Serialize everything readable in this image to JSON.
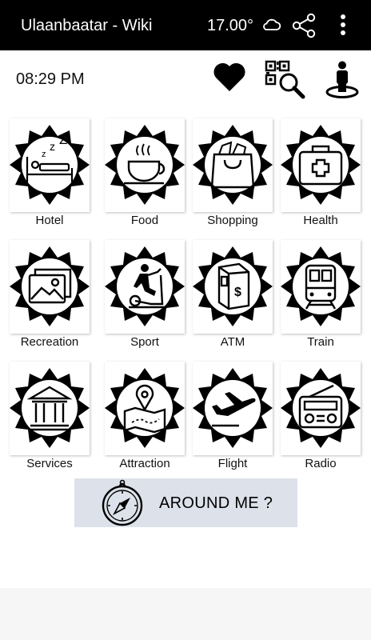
{
  "appbar": {
    "title": "Ulaanbaatar - Wiki",
    "temperature": "17.00°",
    "weather_icon": "cloud-icon",
    "share_icon": "share-icon",
    "menu_icon": "more-vert-icon"
  },
  "subbar": {
    "time": "08:29 PM",
    "favorite_icon": "heart-icon",
    "qr_icon": "qr-search-icon",
    "location_icon": "person-pin-icon"
  },
  "categories": [
    {
      "label": "Hotel",
      "icon": "bed-icon"
    },
    {
      "label": "Food",
      "icon": "coffee-cup-icon"
    },
    {
      "label": "Shopping",
      "icon": "shopping-bag-icon"
    },
    {
      "label": "Health",
      "icon": "first-aid-kit-icon"
    },
    {
      "label": "Recreation",
      "icon": "photos-icon"
    },
    {
      "label": "Sport",
      "icon": "exercise-bike-icon"
    },
    {
      "label": "ATM",
      "icon": "atm-machine-icon"
    },
    {
      "label": "Train",
      "icon": "train-icon"
    },
    {
      "label": "Services",
      "icon": "government-building-icon"
    },
    {
      "label": "Attraction",
      "icon": "map-pin-icon"
    },
    {
      "label": "Flight",
      "icon": "airplane-icon"
    },
    {
      "label": "Radio",
      "icon": "radio-icon"
    }
  ],
  "around_me": {
    "label": "AROUND ME ?",
    "icon": "compass-icon"
  },
  "colors": {
    "appbar_bg": "#000000",
    "around_bg": "#dde1e9",
    "badge": "#000000"
  }
}
